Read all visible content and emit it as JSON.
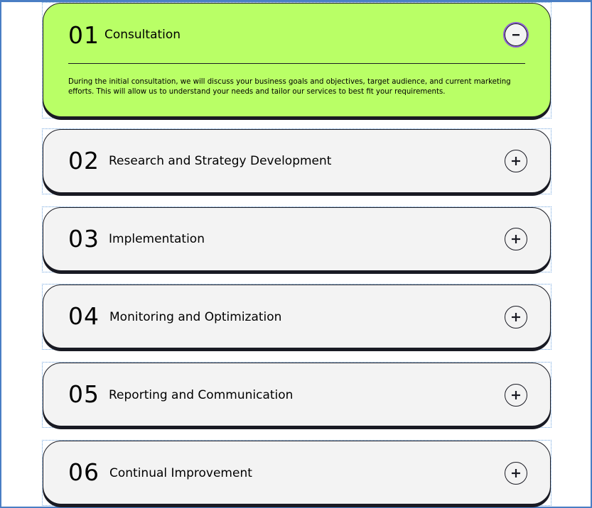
{
  "items": [
    {
      "number": "01",
      "title": "Consultation",
      "expanded": true,
      "toggle_icon": "minus-icon",
      "description": "During the initial consultation, we will discuss your business goals and objectives, target audience, and current marketing efforts. This will allow us to understand your needs and tailor our services to best fit your requirements."
    },
    {
      "number": "02",
      "title": "Research and Strategy Development",
      "expanded": false,
      "toggle_icon": "plus-icon"
    },
    {
      "number": "03",
      "title": "Implementation",
      "expanded": false,
      "toggle_icon": "plus-icon"
    },
    {
      "number": "04",
      "title": "Monitoring and Optimization",
      "expanded": false,
      "toggle_icon": "plus-icon"
    },
    {
      "number": "05",
      "title": "Reporting and Communication",
      "expanded": false,
      "toggle_icon": "plus-icon"
    },
    {
      "number": "06",
      "title": "Continual Improvement",
      "expanded": false,
      "toggle_icon": "plus-icon"
    }
  ],
  "colors": {
    "open_card": "#b9ff66",
    "closed_card": "#f3f3f3",
    "dark": "#191a23",
    "focus_outline": "#8c5ad8",
    "container_outline": "#6fa4de"
  }
}
